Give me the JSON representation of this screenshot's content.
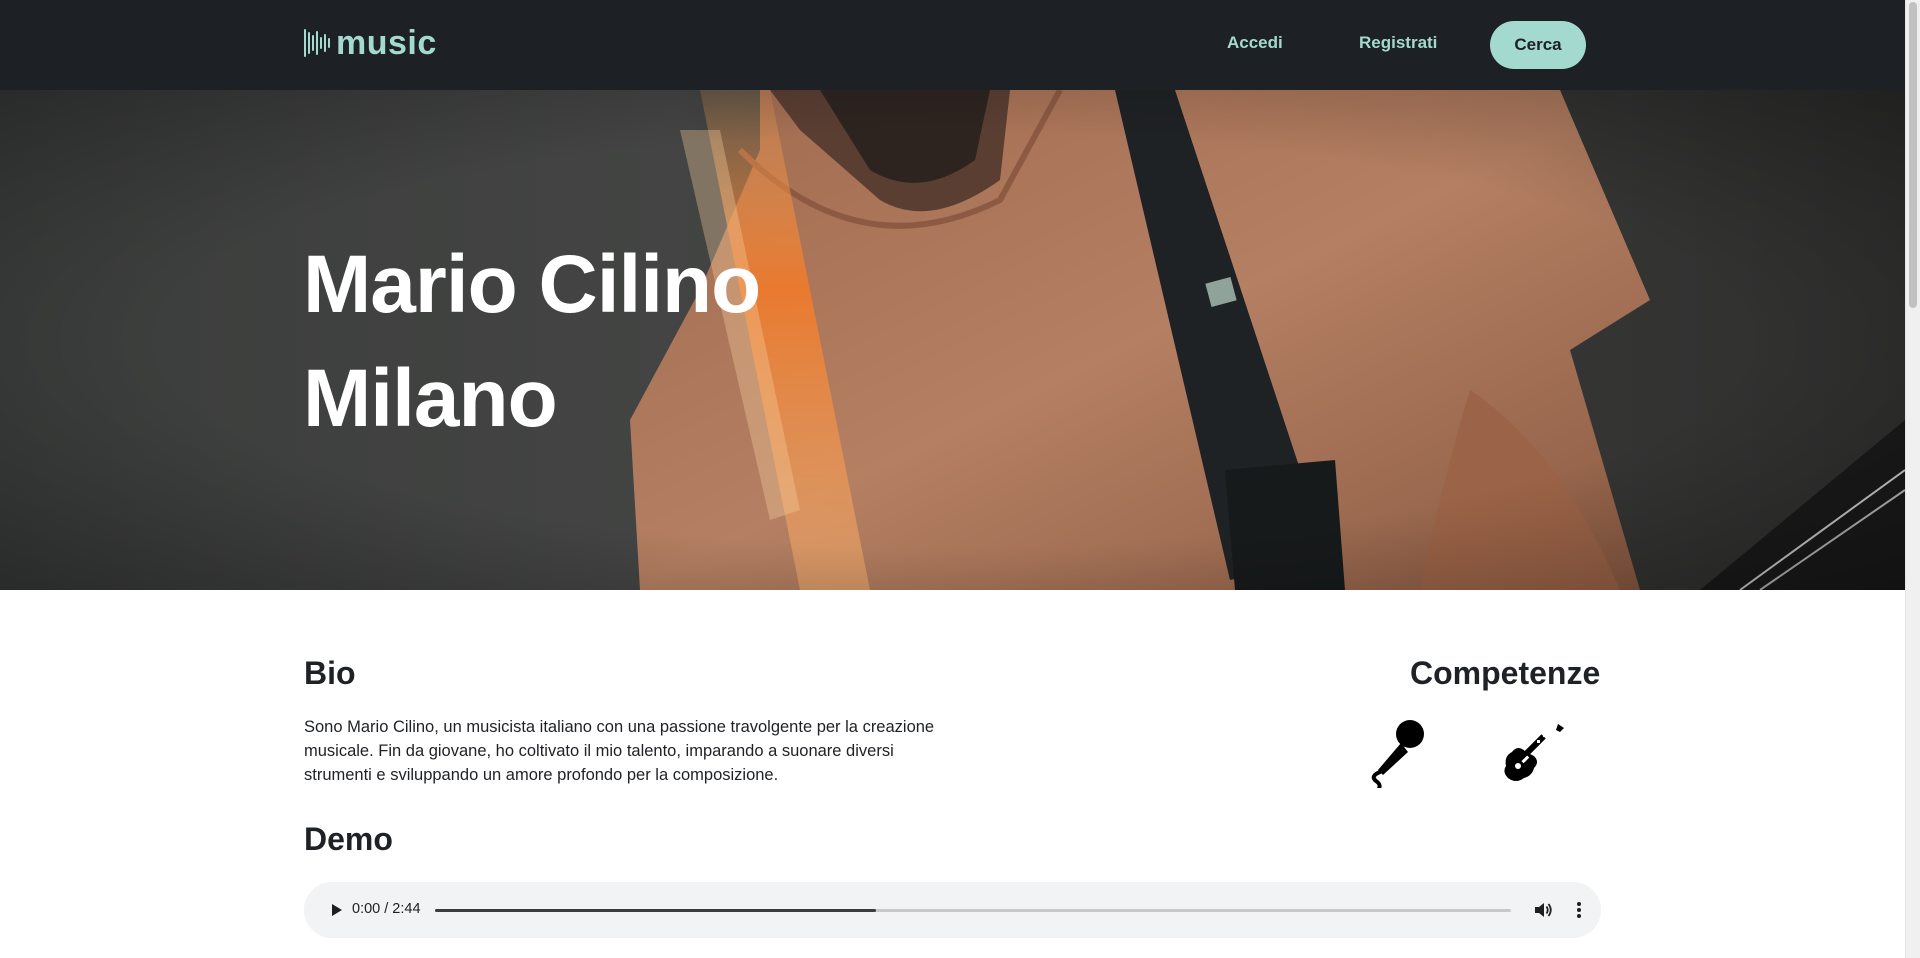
{
  "navbar": {
    "logo_text": "music",
    "login_label": "Accedi",
    "register_label": "Registrati",
    "search_label": "Cerca"
  },
  "hero": {
    "name": "Mario Cilino",
    "city": "Milano"
  },
  "bio": {
    "title": "Bio",
    "text": "Sono Mario Cilino, un musicista italiano con una passione travolgente per la creazione musicale. Fin da giovane, ho coltivato il mio talento, imparando a suonare diversi strumenti e sviluppando un amore profondo per la composizione."
  },
  "skills": {
    "title": "Competenze",
    "icons": [
      "microphone-icon",
      "electric-guitar-icon"
    ]
  },
  "demo": {
    "title": "Demo",
    "player": {
      "time": "0:00 / 2:44",
      "progress_fraction": 0.41
    }
  },
  "colors": {
    "navbar_bg": "#1d2024",
    "accent": "#a3d9cf",
    "text": "#1e2125"
  }
}
